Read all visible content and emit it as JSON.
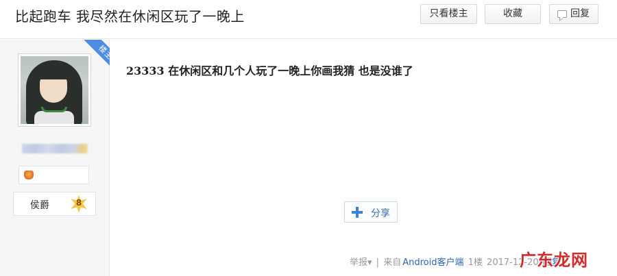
{
  "header": {
    "thread_title": "比起跑车 我尽然在休闲区玩了一晚上",
    "only_op_label": "只看楼主",
    "collect_label": "收藏",
    "reply_label": "回复"
  },
  "author": {
    "op_tag": "楼主",
    "level_name": "侯爵",
    "level_number": "8"
  },
  "post": {
    "content": "23333 在休闲区和几个人玩了一晚上你画我猜 也是没谁了",
    "share_label": "分享"
  },
  "footer": {
    "report_label": "举报▾",
    "separator": "|",
    "source_prefix": "来自",
    "source_client": "Android客户端",
    "floor": "1楼",
    "timestamp": "2017-12-20",
    "reply_link": "回复"
  },
  "watermark": {
    "text": "广东龙网"
  }
}
